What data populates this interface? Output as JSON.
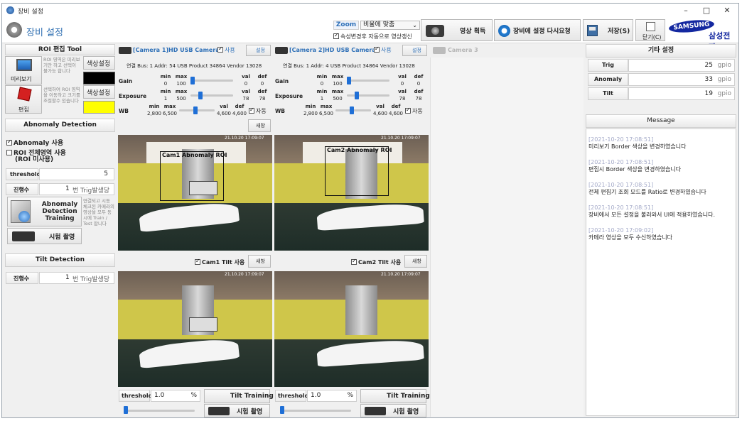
{
  "window": {
    "title": "장비 설정",
    "minimize": "–",
    "maximize": "□",
    "close": "✕"
  },
  "header": {
    "title": "장비 설정",
    "zoom_label": "Zoom",
    "zoom_value": "비율에 맞춤",
    "auto_update_label": "속성변경후 자동으로 영상갱신",
    "acquire_label": "영상 획득",
    "reset_label": "장비에 설정 다시요청",
    "save_label": "저장(S)",
    "close_label": "닫기(C)",
    "brand": "SAMSUNG",
    "brand_sub": "삼성전자"
  },
  "roi": {
    "title": "ROI 편집 Tool",
    "preview_label": "미리보기",
    "preview_desc": "ROI 영역은 미리보기만 하고 선택이 불가능 합니다",
    "preview_color_label": "색상설정",
    "preview_color": "#000000",
    "edit_label": "편집",
    "edit_desc": "선택하여 ROI 영역을 이동하고 크기를 조절할수 있습니다",
    "edit_color_label": "색상설정",
    "edit_color": "#ffff00"
  },
  "abnomaly": {
    "title": "Abnomaly Detection",
    "use_label": "Abnomaly 사용",
    "full_roi_label": "ROI 전체영역 사용",
    "full_roi_sub": "(ROI 미사용)",
    "threshold_label": "threshold",
    "threshold_value": "5",
    "progress_label": "진행수",
    "progress_value": "1",
    "progress_suffix": "번 Trig발생당",
    "training_label": "Abnomaly Detection Training",
    "training_desc": "연결되고 시동 체크된 카메라의 영상을 모두 동시에 Train / Test 합니다",
    "test_label": "시험 촬영"
  },
  "tilt": {
    "title": "Tilt Detection",
    "progress_label": "진행수",
    "progress_value": "1",
    "progress_suffix": "번 Trig발생당"
  },
  "cameras": [
    {
      "title": "[Camera 1]HD USB Camera",
      "use_label": "사용",
      "settings_label": "설정",
      "info": "연결 Bus: 1  Addr: 54  USB Product 34864  Vendor 13028",
      "gain": {
        "label": "Gain",
        "min": "0",
        "max": "100",
        "val": "0",
        "def": "0"
      },
      "exposure": {
        "label": "Exposure",
        "min": "1",
        "max": "500",
        "val": "78",
        "def": "78"
      },
      "wb": {
        "label": "WB",
        "min": "2,800",
        "max": "6,500",
        "val": "4,600",
        "def": "4,600",
        "auto": "자동"
      },
      "refresh_label": "새창",
      "roi_label": "Cam1 Abnomaly ROI",
      "timestamp": "21.10.20 17:09:07",
      "tilt_use_label": "Cam1 Tilt 사용",
      "threshold_label": "threshold",
      "threshold_value": "1.0",
      "threshold_unit": "%",
      "tilt_training_label": "Tilt Training",
      "test_label": "시험 촬영"
    },
    {
      "title": "[Camera 2]HD USB Camera",
      "use_label": "사용",
      "settings_label": "설정",
      "info": "연결 Bus: 1  Addr: 4  USB Product 34864  Vendor 13028",
      "gain": {
        "label": "Gain",
        "min": "0",
        "max": "100",
        "val": "0",
        "def": "0"
      },
      "exposure": {
        "label": "Exposure",
        "min": "1",
        "max": "500",
        "val": "78",
        "def": "78"
      },
      "wb": {
        "label": "WB",
        "min": "2,800",
        "max": "6,500",
        "val": "4,600",
        "def": "4,600",
        "auto": "자동"
      },
      "refresh_label": "새창",
      "roi_label": "Cam2 Abnomaly ROI",
      "timestamp": "21.10.20 17:09:07",
      "tilt_use_label": "Cam2 Tilt 사용",
      "threshold_label": "threshold",
      "threshold_value": "1.0",
      "threshold_unit": "%",
      "tilt_training_label": "Tilt Training",
      "test_label": "시험 촬영"
    }
  ],
  "camera3": {
    "title": "Camera 3"
  },
  "header_labels": {
    "min": "min",
    "max": "max",
    "val": "val",
    "def": "def"
  },
  "etc": {
    "title": "기타 설정",
    "rows": [
      {
        "label": "Trig",
        "value": "25",
        "unit": "gpio"
      },
      {
        "label": "Anomaly",
        "value": "33",
        "unit": "gpio"
      },
      {
        "label": "Tilt",
        "value": "19",
        "unit": "gpio"
      }
    ]
  },
  "message": {
    "title": "Message",
    "items": [
      {
        "ts": "[2021-10-20 17:08:51]",
        "text": "미리보기 Border 색상을 변경하였습니다"
      },
      {
        "ts": "[2021-10-20 17:08:51]",
        "text": "편집시 Border 색상을 변경하였습니다"
      },
      {
        "ts": "[2021-10-20 17:08:51]",
        "text": "전체 편집기 조회 모드를 Ratio로 변경하였습니다"
      },
      {
        "ts": "[2021-10-20 17:08:51]",
        "text": "장비에서 모든 설정을 불러와서 UI에 적용하였습니다."
      },
      {
        "ts": "[2021-10-20 17:09:02]",
        "text": "카메라 영상을 모두 수신하였습니다"
      }
    ]
  }
}
